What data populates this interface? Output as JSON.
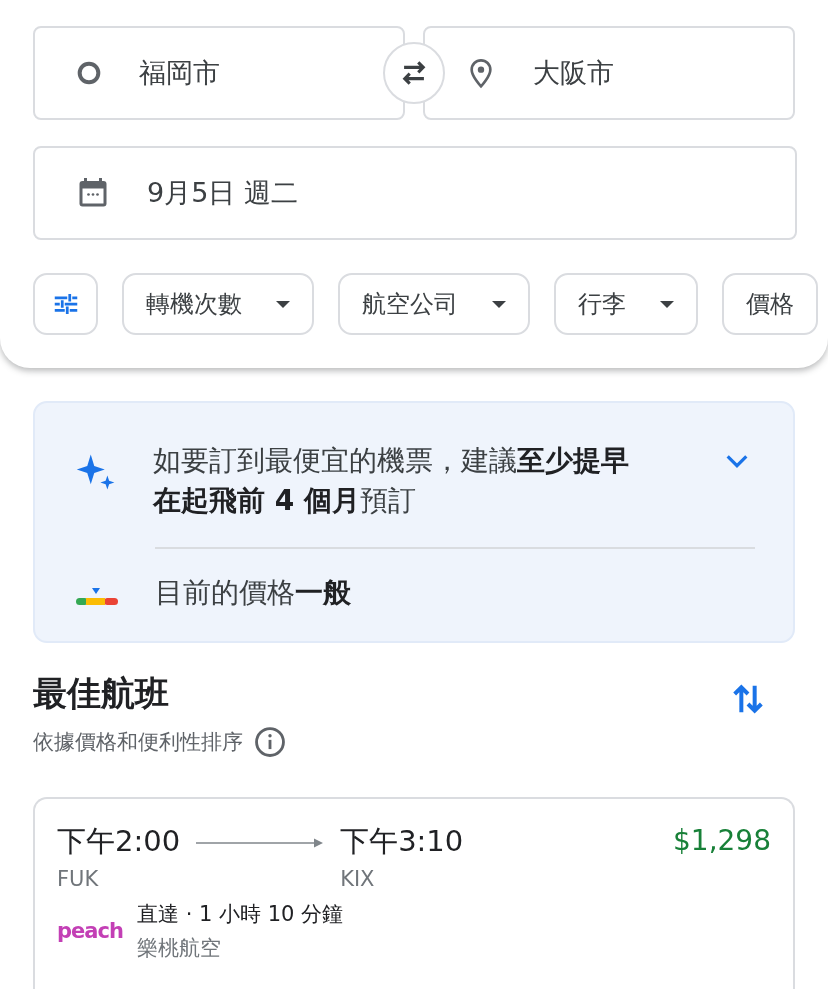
{
  "search": {
    "origin": "福岡市",
    "destination": "大阪市",
    "date": "9月5日 週二"
  },
  "filters": [
    {
      "label": "轉機次數",
      "dropdown": true
    },
    {
      "label": "航空公司",
      "dropdown": true
    },
    {
      "label": "行李",
      "dropdown": true
    },
    {
      "label": "價格",
      "dropdown": false
    }
  ],
  "insights": {
    "expanded": false,
    "tip": "如要訂到最便宜的機票，建議**至少提早在起飛前 4 個月**預訂",
    "price_status": "目前的價格**一般**"
  },
  "results": {
    "title": "最佳航班",
    "subtitle": "依據價格和便利性排序",
    "flights": [
      {
        "depart_time": "下午2:00",
        "depart_airport": "FUK",
        "arrive_time": "下午3:10",
        "arrive_airport": "KIX",
        "price": "$1,298",
        "stops_duration": "直達 · 1 小時 10 分鐘",
        "airline_logo": "peach",
        "airline": "樂桃航空"
      }
    ]
  }
}
